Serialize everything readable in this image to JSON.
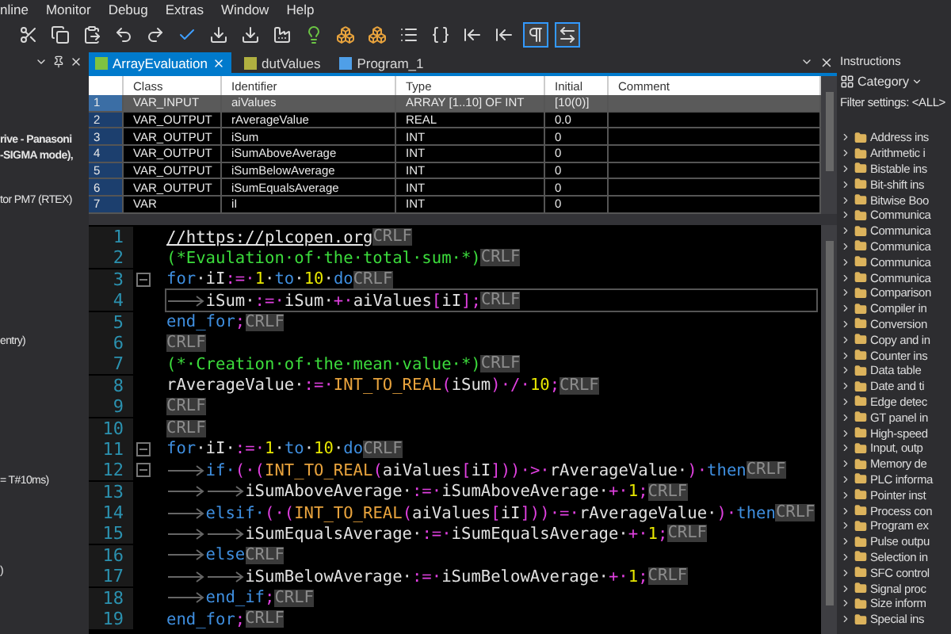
{
  "menu": [
    "nline",
    "Monitor",
    "Debug",
    "Extras",
    "Window",
    "Help"
  ],
  "toolbar": {
    "buttons": [
      {
        "kind": "cut"
      },
      {
        "kind": "copy"
      },
      {
        "kind": "paste"
      },
      {
        "kind": "undo"
      },
      {
        "kind": "redo"
      },
      {
        "kind": "check"
      },
      {
        "kind": "download"
      },
      {
        "kind": "download"
      },
      {
        "kind": "build"
      },
      {
        "kind": "bulb"
      },
      {
        "kind": "blocks"
      },
      {
        "kind": "blocks"
      },
      {
        "kind": "list"
      },
      {
        "kind": "brackets"
      },
      {
        "kind": "step"
      },
      {
        "kind": "step"
      }
    ],
    "toggles": [
      {
        "kind": "pilcrow",
        "on": true
      },
      {
        "kind": "swap",
        "on": true
      }
    ]
  },
  "left_panel": {
    "lines": [
      {
        "text": "rive - Panasoni",
        "bold": true
      },
      {
        "text": "-SIGMA mode),",
        "bold": true
      },
      {
        "text": "tor PM7 (RTEX)",
        "bold": false
      },
      {
        "text": "entry)",
        "bold": false
      },
      {
        "text": "= T#10ms)",
        "bold": false
      },
      {
        "text": ")",
        "bold": false
      }
    ]
  },
  "tabs": [
    {
      "label": "ArrayEvaluation",
      "selected": true,
      "kind": "program"
    },
    {
      "label": "dutValues",
      "selected": false,
      "kind": "struct"
    },
    {
      "label": "Program_1",
      "selected": false,
      "kind": "task"
    }
  ],
  "table": {
    "columns": [
      "Class",
      "Identifier",
      "Type",
      "Initial",
      "Comment"
    ],
    "rows": [
      {
        "number": "1",
        "class": "VAR_INPUT",
        "identifier": "aiValues",
        "type": "ARRAY [1..10] OF INT",
        "initial": "[10(0)]",
        "selected": true
      },
      {
        "number": "2",
        "class": "VAR_OUTPUT",
        "identifier": "rAverageValue",
        "type": "REAL",
        "initial": "0.0",
        "selected": false
      },
      {
        "number": "3",
        "class": "VAR_OUTPUT",
        "identifier": "iSum",
        "type": "INT",
        "initial": "0",
        "selected": false
      },
      {
        "number": "4",
        "class": "VAR_OUTPUT",
        "identifier": "iSumAboveAverage",
        "type": "INT",
        "initial": "0",
        "selected": false
      },
      {
        "number": "5",
        "class": "VAR_OUTPUT",
        "identifier": "iSumBelowAverage",
        "type": "INT",
        "initial": "0",
        "selected": false
      },
      {
        "number": "6",
        "class": "VAR_OUTPUT",
        "identifier": "iSumEqualsAverage",
        "type": "INT",
        "initial": "0",
        "selected": false
      },
      {
        "number": "7",
        "class": "VAR",
        "identifier": "iI",
        "type": "INT",
        "initial": "0",
        "selected": false
      }
    ]
  },
  "code": {
    "lines": [
      {
        "number": "1",
        "foldable": false,
        "current": false,
        "eol": "CRLF",
        "tokens": [
          {
            "kind": "url",
            "text": "//https://plcopen.org"
          }
        ]
      },
      {
        "number": "2",
        "foldable": false,
        "current": false,
        "eol": "CRLF",
        "tokens": [
          {
            "kind": "comment",
            "text": "(*Evaulation·of·the·total·sum·*)"
          }
        ]
      },
      {
        "number": "3",
        "foldable": true,
        "current": false,
        "eol": "CRLF",
        "tokens": [
          {
            "kind": "keyword",
            "text": "for"
          },
          {
            "kind": "ident",
            "text": "·iI"
          },
          {
            "kind": "op",
            "text": ":=·"
          },
          {
            "kind": "number",
            "text": "1"
          },
          {
            "kind": "ident",
            "text": "·"
          },
          {
            "kind": "keyword",
            "text": "to"
          },
          {
            "kind": "ident",
            "text": "·"
          },
          {
            "kind": "number",
            "text": "10"
          },
          {
            "kind": "ident",
            "text": "·"
          },
          {
            "kind": "keyword",
            "text": "do"
          }
        ]
      },
      {
        "number": "4",
        "foldable": false,
        "current": true,
        "eol": "CRLF",
        "tokens": [
          {
            "kind": "tab"
          },
          {
            "kind": "ident",
            "text": "iSum·"
          },
          {
            "kind": "op",
            "text": ":=·"
          },
          {
            "kind": "ident",
            "text": "iSum·"
          },
          {
            "kind": "op",
            "text": "+·"
          },
          {
            "kind": "ident",
            "text": "aiValues"
          },
          {
            "kind": "op",
            "text": "["
          },
          {
            "kind": "ident",
            "text": "iI"
          },
          {
            "kind": "op",
            "text": "];"
          }
        ]
      },
      {
        "number": "5",
        "foldable": false,
        "current": false,
        "eol": "CRLF",
        "tokens": [
          {
            "kind": "keyword",
            "text": "end_for"
          },
          {
            "kind": "op",
            "text": ";"
          }
        ]
      },
      {
        "number": "6",
        "foldable": false,
        "current": false,
        "eol": "CRLF"
      },
      {
        "number": "7",
        "foldable": false,
        "current": false,
        "eol": "CRLF",
        "tokens": [
          {
            "kind": "comment",
            "text": "(*·Creation·of·the·mean·value·*)"
          }
        ]
      },
      {
        "number": "8",
        "foldable": false,
        "current": false,
        "eol": "CRLF",
        "tokens": [
          {
            "kind": "ident",
            "text": "rAverageValue·"
          },
          {
            "kind": "op",
            "text": ":=·"
          },
          {
            "kind": "function",
            "text": "INT_TO_REAL"
          },
          {
            "kind": "op",
            "text": "("
          },
          {
            "kind": "ident",
            "text": "iSum"
          },
          {
            "kind": "op",
            "text": ")·/·"
          },
          {
            "kind": "number",
            "text": "10"
          },
          {
            "kind": "op",
            "text": ";"
          }
        ]
      },
      {
        "number": "9",
        "foldable": false,
        "current": false,
        "eol": "CRLF"
      },
      {
        "number": "10",
        "foldable": false,
        "current": false,
        "eol": "CRLF"
      },
      {
        "number": "11",
        "foldable": true,
        "current": false,
        "eol": "CRLF",
        "tokens": [
          {
            "kind": "keyword",
            "text": "for"
          },
          {
            "kind": "ident",
            "text": "·iI·"
          },
          {
            "kind": "op",
            "text": ":=·"
          },
          {
            "kind": "number",
            "text": "1"
          },
          {
            "kind": "ident",
            "text": "·"
          },
          {
            "kind": "keyword",
            "text": "to"
          },
          {
            "kind": "ident",
            "text": "·"
          },
          {
            "kind": "number",
            "text": "10"
          },
          {
            "kind": "ident",
            "text": "·"
          },
          {
            "kind": "keyword",
            "text": "do"
          }
        ]
      },
      {
        "number": "12",
        "foldable": true,
        "current": false,
        "eol": "CRLF",
        "tokens": [
          {
            "kind": "tab"
          },
          {
            "kind": "keyword",
            "text": "if·"
          },
          {
            "kind": "op",
            "text": "(·("
          },
          {
            "kind": "function",
            "text": "INT_TO_REAL"
          },
          {
            "kind": "op",
            "text": "("
          },
          {
            "kind": "ident",
            "text": "aiValues"
          },
          {
            "kind": "op",
            "text": "["
          },
          {
            "kind": "ident",
            "text": "iI"
          },
          {
            "kind": "op",
            "text": "]))·>·"
          },
          {
            "kind": "ident",
            "text": "rAverageValue·"
          },
          {
            "kind": "op",
            "text": ")·"
          },
          {
            "kind": "keyword",
            "text": "then"
          }
        ]
      },
      {
        "number": "13",
        "foldable": false,
        "current": false,
        "eol": "CRLF",
        "tokens": [
          {
            "kind": "tab"
          },
          {
            "kind": "tab"
          },
          {
            "kind": "ident",
            "text": "iSumAboveAverage·"
          },
          {
            "kind": "op",
            "text": ":=·"
          },
          {
            "kind": "ident",
            "text": "iSumAboveAverage·"
          },
          {
            "kind": "op",
            "text": "+·"
          },
          {
            "kind": "number",
            "text": "1"
          },
          {
            "kind": "op",
            "text": ";"
          }
        ]
      },
      {
        "number": "14",
        "foldable": false,
        "current": false,
        "eol": "CRLF",
        "tokens": [
          {
            "kind": "tab"
          },
          {
            "kind": "keyword",
            "text": "elsif·"
          },
          {
            "kind": "op",
            "text": "(·("
          },
          {
            "kind": "function",
            "text": "INT_TO_REAL"
          },
          {
            "kind": "op",
            "text": "("
          },
          {
            "kind": "ident",
            "text": "aiValues"
          },
          {
            "kind": "op",
            "text": "["
          },
          {
            "kind": "ident",
            "text": "iI"
          },
          {
            "kind": "op",
            "text": "]))·=·"
          },
          {
            "kind": "ident",
            "text": "rAverageValue·"
          },
          {
            "kind": "op",
            "text": ")·"
          },
          {
            "kind": "keyword",
            "text": "then"
          }
        ]
      },
      {
        "number": "15",
        "foldable": false,
        "current": false,
        "eol": "CRLF",
        "tokens": [
          {
            "kind": "tab"
          },
          {
            "kind": "tab"
          },
          {
            "kind": "ident",
            "text": "iSumEqualsAverage·"
          },
          {
            "kind": "op",
            "text": ":=·"
          },
          {
            "kind": "ident",
            "text": "iSumEqualsAverage·"
          },
          {
            "kind": "op",
            "text": "+·"
          },
          {
            "kind": "number",
            "text": "1"
          },
          {
            "kind": "op",
            "text": ";"
          }
        ]
      },
      {
        "number": "16",
        "foldable": false,
        "current": false,
        "eol": "CRLF",
        "tokens": [
          {
            "kind": "tab"
          },
          {
            "kind": "keyword",
            "text": "else"
          }
        ]
      },
      {
        "number": "17",
        "foldable": false,
        "current": false,
        "eol": "CRLF",
        "tokens": [
          {
            "kind": "tab"
          },
          {
            "kind": "tab"
          },
          {
            "kind": "ident",
            "text": "iSumBelowAverage·"
          },
          {
            "kind": "op",
            "text": ":=·"
          },
          {
            "kind": "ident",
            "text": "iSumBelowAverage·"
          },
          {
            "kind": "op",
            "text": "+·"
          },
          {
            "kind": "number",
            "text": "1"
          },
          {
            "kind": "op",
            "text": ";"
          }
        ]
      },
      {
        "number": "18",
        "foldable": false,
        "current": false,
        "eol": "CRLF",
        "tokens": [
          {
            "kind": "tab"
          },
          {
            "kind": "keyword",
            "text": "end_if"
          },
          {
            "kind": "op",
            "text": ";"
          }
        ]
      },
      {
        "number": "19",
        "foldable": false,
        "current": false,
        "eol": "CRLF",
        "tokens": [
          {
            "kind": "keyword",
            "text": "end_for"
          },
          {
            "kind": "op",
            "text": ";"
          }
        ]
      }
    ]
  },
  "instructions": {
    "title": "Instructions",
    "category": "Category",
    "filter": "Filter settings: <ALL>",
    "items": [
      {
        "label": "Address ins",
        "expanded": false
      },
      {
        "label": "Arithmetic i",
        "expanded": false
      },
      {
        "label": "Bistable ins",
        "expanded": false
      },
      {
        "label": "Bit-shift ins",
        "expanded": false
      },
      {
        "label": "Bitwise Boo",
        "expanded": false
      },
      {
        "label": "Communica",
        "expanded": false
      },
      {
        "label": "Communica",
        "expanded": false
      },
      {
        "label": "Communica",
        "expanded": false
      },
      {
        "label": "Communica",
        "expanded": false
      },
      {
        "label": "Communica",
        "expanded": false
      },
      {
        "label": "Comparison",
        "expanded": false
      },
      {
        "label": "Compiler in",
        "expanded": false
      },
      {
        "label": "Conversion",
        "expanded": false
      },
      {
        "label": "Copy and in",
        "expanded": false
      },
      {
        "label": "Counter ins",
        "expanded": false
      },
      {
        "label": "Data table",
        "expanded": false
      },
      {
        "label": "Date and ti",
        "expanded": false
      },
      {
        "label": "Edge detec",
        "expanded": false
      },
      {
        "label": "GT panel in",
        "expanded": false
      },
      {
        "label": "High-speed",
        "expanded": false
      },
      {
        "label": "Input, outp",
        "expanded": false
      },
      {
        "label": "Memory de",
        "expanded": false
      },
      {
        "label": "PLC informa",
        "expanded": false
      },
      {
        "label": "Pointer inst",
        "expanded": false
      },
      {
        "label": "Process con",
        "expanded": false
      },
      {
        "label": "Program ex",
        "expanded": false
      },
      {
        "label": "Pulse outpu",
        "expanded": false
      },
      {
        "label": "Selection in",
        "expanded": false
      },
      {
        "label": "SFC control",
        "expanded": false
      },
      {
        "label": "Signal proc",
        "expanded": false
      },
      {
        "label": "Size inform",
        "expanded": false
      },
      {
        "label": "Special ins",
        "expanded": false
      }
    ]
  }
}
